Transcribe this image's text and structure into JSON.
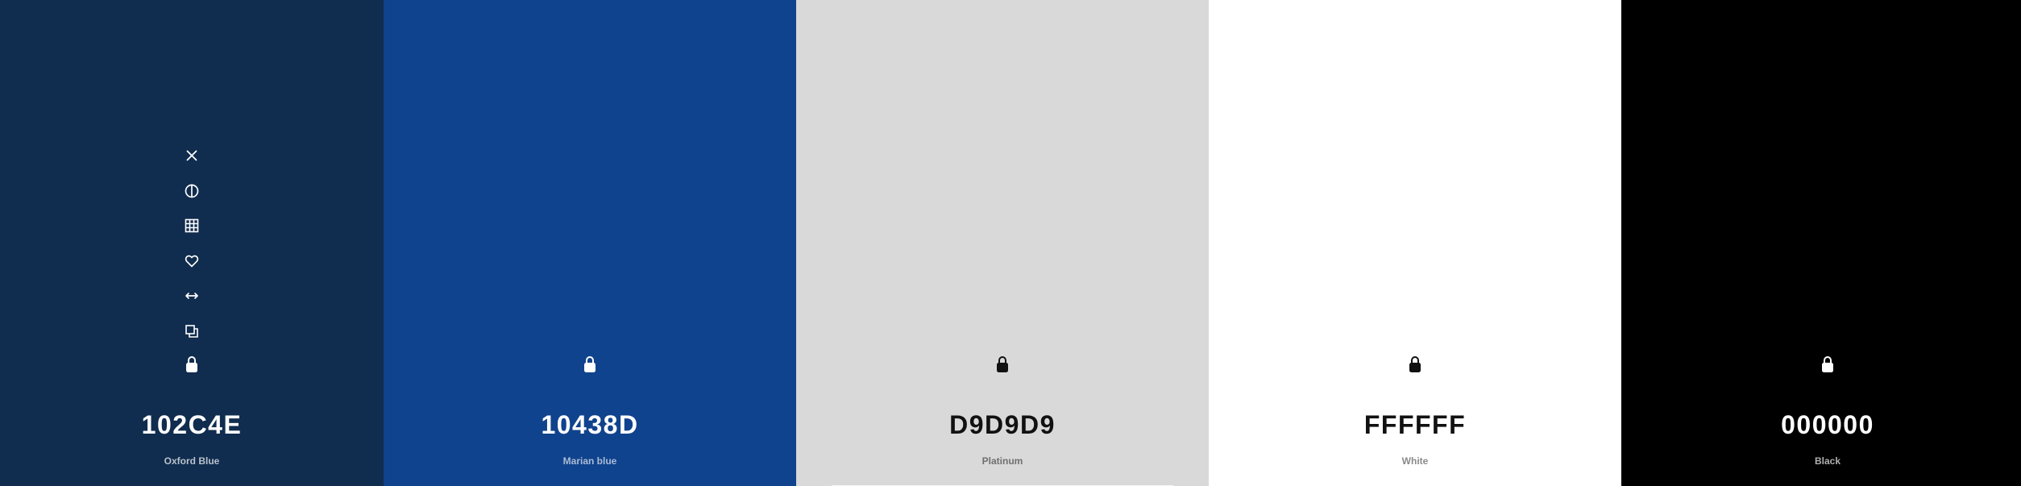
{
  "toolbar": {
    "icons": [
      "close-icon",
      "contrast-icon",
      "grid-icon",
      "heart-icon",
      "swap-icon",
      "copy-icon",
      "lock-icon"
    ]
  },
  "swatches": [
    {
      "hex": "102C4E",
      "name": "Oxford Blue",
      "bg": "#102C4E",
      "fg": "#FFFFFF",
      "name_color": "#B9C2CC"
    },
    {
      "hex": "10438D",
      "name": "Marian blue",
      "bg": "#10438D",
      "fg": "#FFFFFF",
      "name_color": "#A9BBD6"
    },
    {
      "hex": "D9D9D9",
      "name": "Platinum",
      "bg": "#D9D9D9",
      "fg": "#111111",
      "name_color": "#707070"
    },
    {
      "hex": "FFFFFF",
      "name": "White",
      "bg": "#FFFFFF",
      "fg": "#111111",
      "name_color": "#8A8A8A"
    },
    {
      "hex": "000000",
      "name": "Black",
      "bg": "#000000",
      "fg": "#FFFFFF",
      "name_color": "#B0B0B0"
    }
  ]
}
